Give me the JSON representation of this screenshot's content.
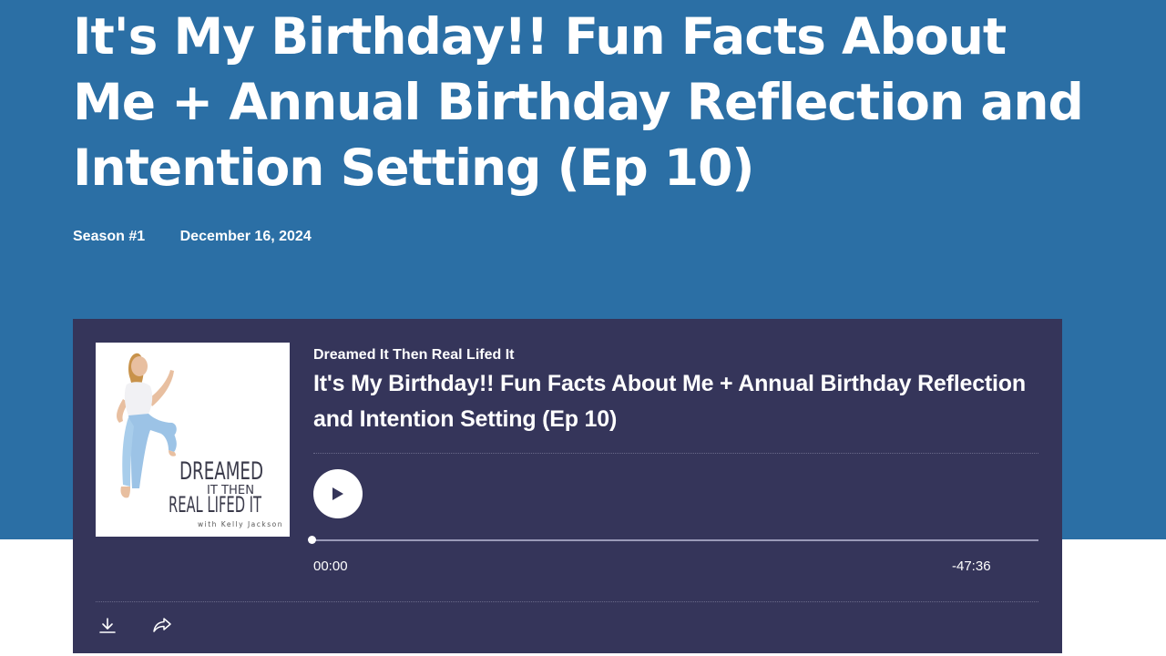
{
  "page": {
    "title": "It's My Birthday!! Fun Facts About Me + Annual Birthday Reflection and Intention Setting (Ep 10)",
    "season": "Season #1",
    "date": "December 16, 2024"
  },
  "player": {
    "show_name": "Dreamed It Then Real Lifed It",
    "episode_title": "It's My Birthday!! Fun Facts About Me + Annual Birthday Reflection and Intention Setting (Ep 10)",
    "current_time": "00:00",
    "remaining_time": "-47:36",
    "progress": 0,
    "cover": {
      "line1": "DREAMED",
      "line2": "IT THEN",
      "line3": "REAL LIFED IT",
      "byline": "with Kelly Jackson"
    },
    "icons": {
      "play": "play-icon",
      "download": "download-icon",
      "share": "share-icon"
    }
  },
  "colors": {
    "hero_bg": "#2b6fa5",
    "player_bg": "#35355a",
    "text": "#ffffff"
  }
}
